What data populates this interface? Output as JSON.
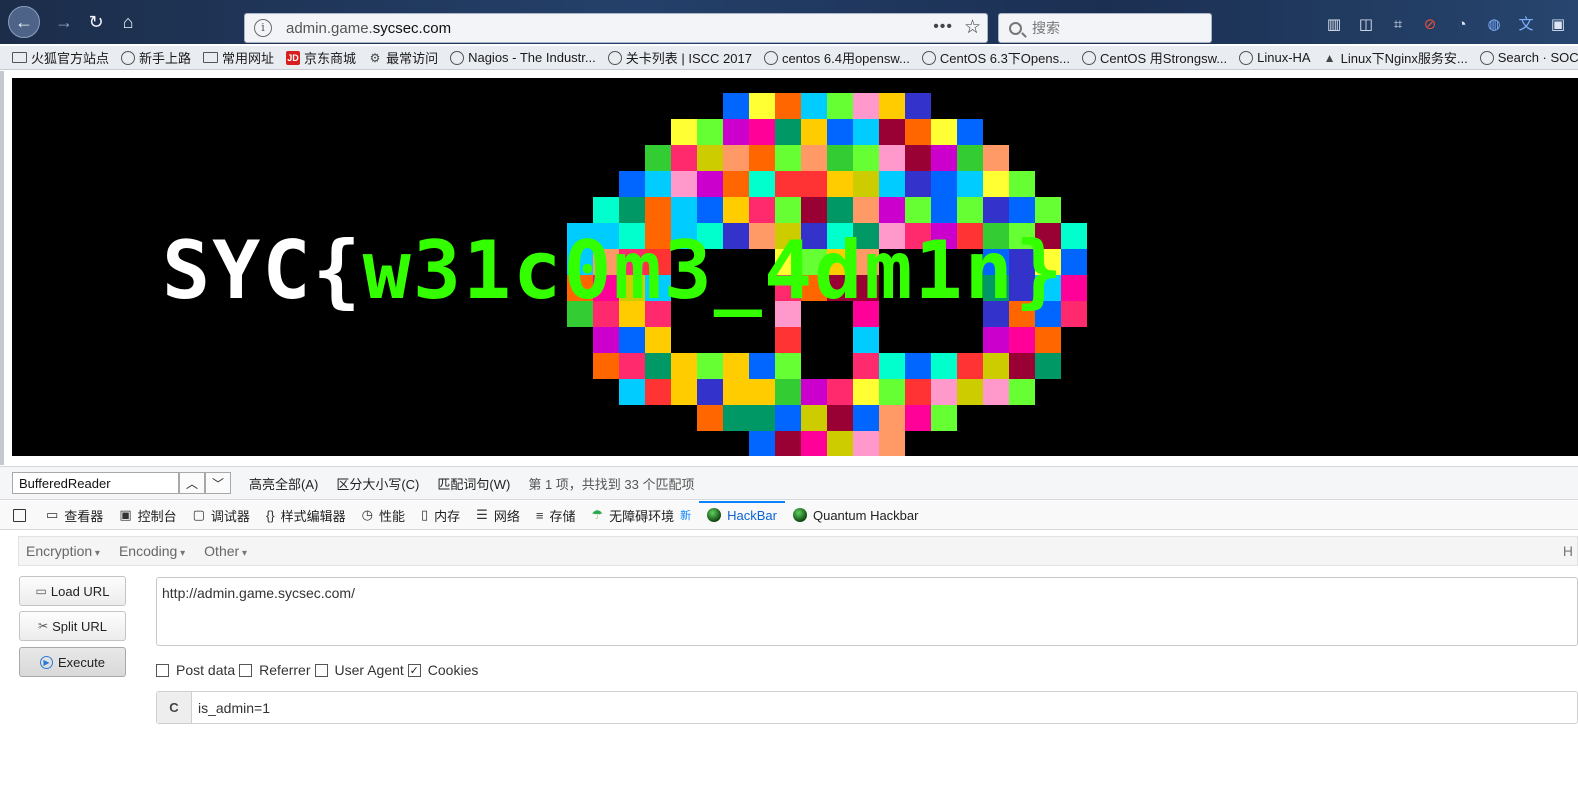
{
  "browser": {
    "url_prefix": "admin.game.",
    "url_domain": "sycsec.com",
    "search_placeholder": "搜索"
  },
  "bookmarks": [
    {
      "label": "火狐官方站点",
      "icon": "folder-icon"
    },
    {
      "label": "新手上路",
      "icon": "globe-icon"
    },
    {
      "label": "常用网址",
      "icon": "folder-icon"
    },
    {
      "label": "京东商城",
      "icon": "jd-icon"
    },
    {
      "label": "最常访问",
      "icon": "gear-icon"
    },
    {
      "label": "Nagios - The Industr...",
      "icon": "globe-icon"
    },
    {
      "label": "关卡列表 | ISCC 2017",
      "icon": "globe-icon"
    },
    {
      "label": "centos 6.4用opensw...",
      "icon": "globe-icon"
    },
    {
      "label": "CentOS 6.3下Opens...",
      "icon": "globe-icon"
    },
    {
      "label": "CentOS 用Strongsw...",
      "icon": "globe-icon"
    },
    {
      "label": "Linux-HA",
      "icon": "globe-icon"
    },
    {
      "label": "Linux下Nginx服务安...",
      "icon": "tux-icon"
    },
    {
      "label": "Search · SOCKS",
      "icon": "globe-icon"
    }
  ],
  "banner": {
    "flag_prefix": "SYC{",
    "flag_body": "w31c0m3_4dm1n}"
  },
  "findbar": {
    "query": "BufferedReader",
    "highlight_all": "高亮全部(A)",
    "match_case": "区分大小写(C)",
    "whole_words": "匹配词句(W)",
    "status": "第 1 项，共找到 33 个匹配项"
  },
  "devtools": {
    "tabs": [
      {
        "label": "查看器",
        "icon": "inspector-icon"
      },
      {
        "label": "控制台",
        "icon": "console-icon"
      },
      {
        "label": "调试器",
        "icon": "debugger-icon"
      },
      {
        "label": "样式编辑器",
        "icon": "style-editor-icon"
      },
      {
        "label": "性能",
        "icon": "performance-icon"
      },
      {
        "label": "内存",
        "icon": "memory-icon"
      },
      {
        "label": "网络",
        "icon": "network-icon"
      },
      {
        "label": "存储",
        "icon": "storage-icon"
      },
      {
        "label": "无障碍环境",
        "icon": "accessibility-icon",
        "badge": "新"
      },
      {
        "label": "HackBar",
        "icon": "hackbar-icon",
        "active": true
      },
      {
        "label": "Quantum Hackbar",
        "icon": "hackbar-icon"
      }
    ]
  },
  "hackbar": {
    "menu": [
      "Encryption",
      "Encoding",
      "Other"
    ],
    "menu_right": "H",
    "load_url": "Load URL",
    "split_url": "Split URL",
    "execute": "Execute",
    "url_value": "http://admin.game.sycsec.com/",
    "options": [
      {
        "label": "Post data",
        "checked": false
      },
      {
        "label": "Referrer",
        "checked": false
      },
      {
        "label": "User Agent",
        "checked": false
      },
      {
        "label": "Cookies",
        "checked": true
      }
    ],
    "cookie_tag": "C",
    "cookie_value": "is_admin=1"
  },
  "colors": {
    "accent": "#0a84ff",
    "flag_green": "#33ff00",
    "banner_bg": "#000000"
  }
}
